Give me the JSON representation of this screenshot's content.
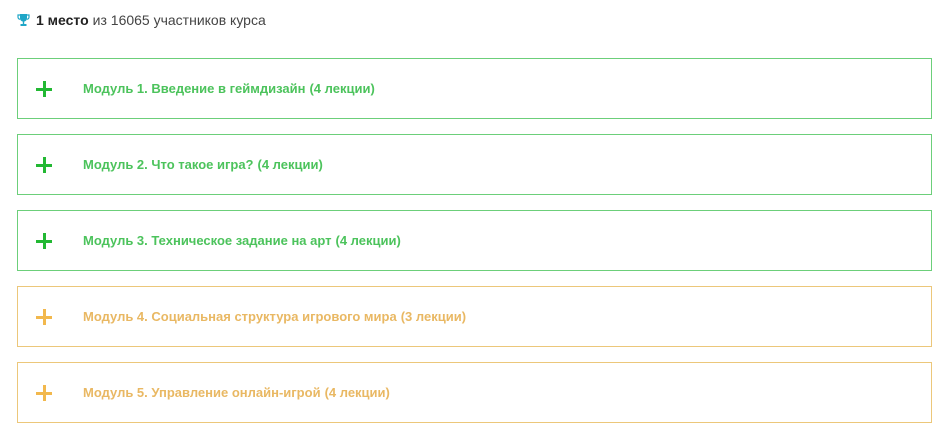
{
  "rank": {
    "place": "1 место",
    "text": "из 16065 участников курса",
    "icon": "trophy-icon"
  },
  "colors": {
    "unlocked_border": "#6ccf7a",
    "unlocked_text": "#4cc35c",
    "unlocked_icon": "#22b833",
    "locked_border": "#ecc77a",
    "locked_text": "#e9b863",
    "locked_icon": "#f2b84d"
  },
  "modules": [
    {
      "title": "Модуль 1. Введение в геймдизайн",
      "count": "(4 лекции)",
      "state": "unlocked"
    },
    {
      "title": "Модуль 2. Что такое игра?",
      "count": "(4 лекции)",
      "state": "unlocked"
    },
    {
      "title": "Модуль 3. Техническое задание на арт",
      "count": "(4 лекции)",
      "state": "unlocked"
    },
    {
      "title": "Модуль 4. Социальная структура игрового мира",
      "count": "(3 лекции)",
      "state": "locked"
    },
    {
      "title": "Модуль 5. Управление онлайн-игрой",
      "count": "(4 лекции)",
      "state": "locked"
    }
  ]
}
